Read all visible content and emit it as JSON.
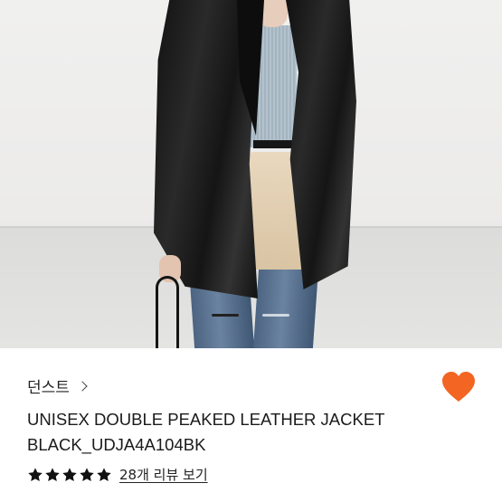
{
  "product_image": {
    "icon": "product-photo",
    "carousel": {
      "total": 2,
      "active_index": 1
    }
  },
  "product": {
    "brand": "던스트",
    "title_line1": "UNISEX DOUBLE PEAKED LEATHER JACKET",
    "title_line2": "BLACK_UDJA4A104BK",
    "rating": {
      "stars": 5,
      "max": 5
    },
    "review_link": "28개 리뷰 보기"
  },
  "colors": {
    "heart": "#f26522",
    "star": "#111111",
    "text": "#1a1a1a"
  },
  "icons": {
    "brand_chevron": "chevron-right-icon",
    "wishlist": "heart-icon",
    "rating": "star-icon"
  }
}
